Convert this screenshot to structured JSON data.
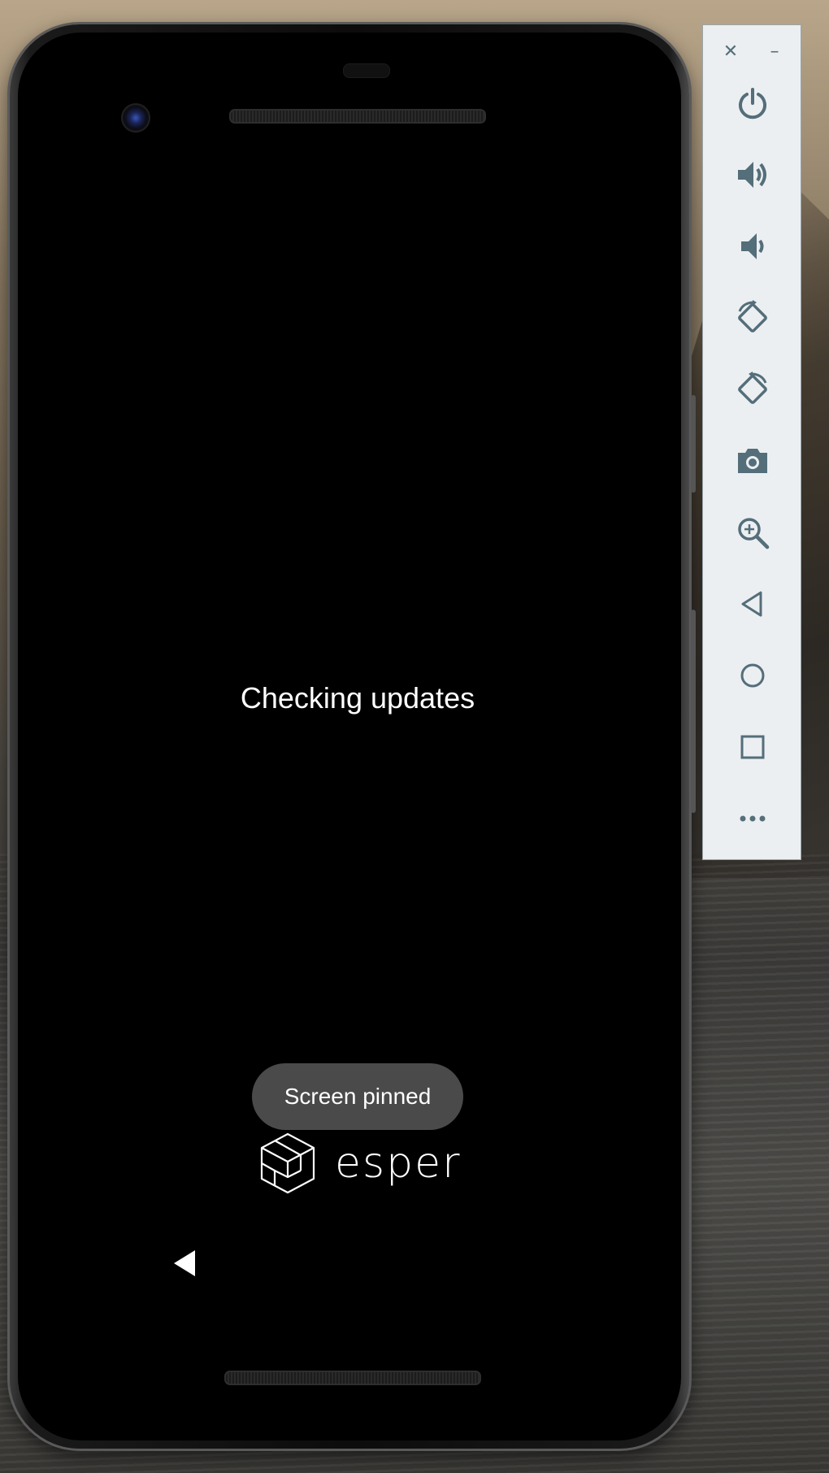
{
  "device_screen": {
    "status_text": "Checking updates",
    "toast_text": "Screen pinned",
    "logo_text": "esper"
  },
  "emulator_panel": {
    "close_label": "✕",
    "minimize_label": "–",
    "buttons": [
      {
        "name": "power",
        "icon": "power-icon"
      },
      {
        "name": "volume-up",
        "icon": "volume-up-icon"
      },
      {
        "name": "volume-down",
        "icon": "volume-down-icon"
      },
      {
        "name": "rotate-left",
        "icon": "rotate-left-icon"
      },
      {
        "name": "rotate-right",
        "icon": "rotate-right-icon"
      },
      {
        "name": "screenshot",
        "icon": "camera-icon"
      },
      {
        "name": "zoom",
        "icon": "zoom-in-icon"
      },
      {
        "name": "back",
        "icon": "back-triangle-icon"
      },
      {
        "name": "home",
        "icon": "home-circle-icon"
      },
      {
        "name": "overview",
        "icon": "overview-square-icon"
      },
      {
        "name": "more",
        "icon": "more-dots-icon"
      }
    ]
  },
  "colors": {
    "panel_bg": "#eceff1",
    "icon_color": "#546e7a",
    "screen_bg": "#000000",
    "toast_bg": "#4a4a4a",
    "text_color": "#ffffff"
  }
}
